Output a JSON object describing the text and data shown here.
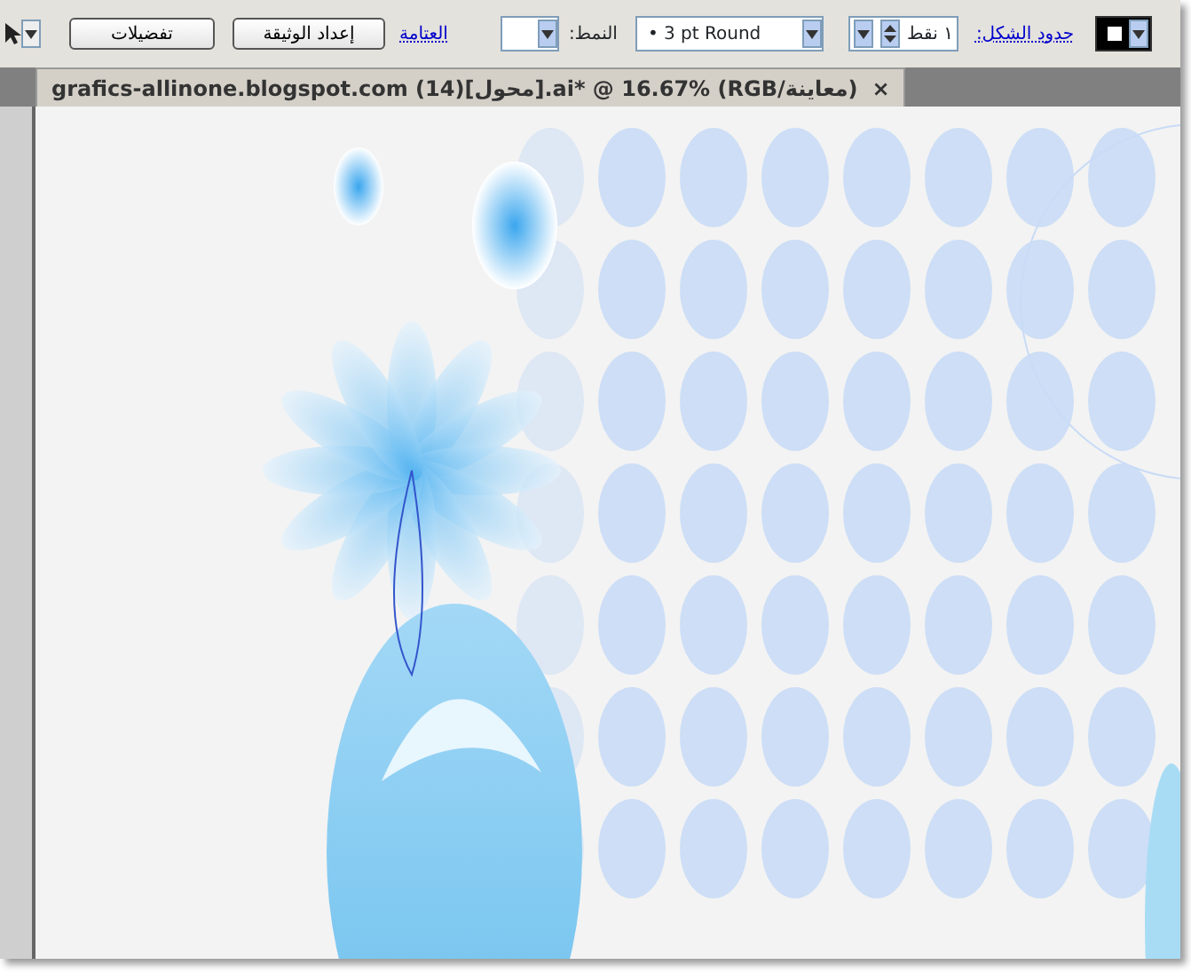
{
  "control_bar": {
    "fill_swatch": {
      "kind": "swatch"
    },
    "stroke_label": "حدود الشكل:",
    "stroke_weight": {
      "value": "١ نقط"
    },
    "brush": {
      "value": "• 3 pt Round"
    },
    "style_label": "النمط:",
    "opacity_label": "العتامة",
    "buttons": [
      "إعداد الوثيقة",
      "تفضيلات"
    ]
  },
  "document_tab": {
    "title": "grafics-allinone.blogspot.com (14)[محول].ai* @ 16.67% (RGB/معاينة)",
    "close": "×",
    "selected": true
  }
}
